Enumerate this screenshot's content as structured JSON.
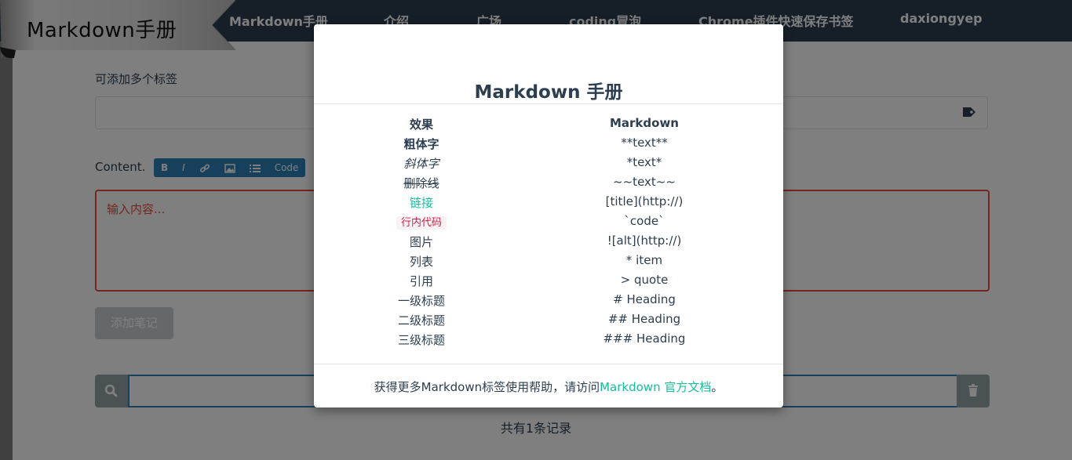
{
  "nav": {
    "logo": "Markdown手册",
    "items": [
      "Markdown手册",
      "介绍",
      "广场",
      "coding冒泡",
      "Chrome插件快速保存书签",
      "daxiongyep"
    ]
  },
  "form": {
    "tags_label": "可添加多个标签",
    "tag_icon": "tag-icon",
    "content_label": "Content.",
    "toolbar": [
      "B",
      "I",
      "link-icon",
      "image-icon",
      "list-icon",
      "Code"
    ],
    "toolbar_code": "Code",
    "textarea_placeholder": "输入内容...",
    "add_button": "添加笔记",
    "search_icon": "search-icon",
    "trash_icon": "trash-icon",
    "records": "共有1条记录"
  },
  "modal": {
    "title": "Markdown 手册",
    "headers": [
      "效果",
      "Markdown"
    ],
    "rows": [
      {
        "effect": "粗体字",
        "syntax": "**text**"
      },
      {
        "effect": "斜体字",
        "syntax": "*text*"
      },
      {
        "effect": "删除线",
        "syntax": "~~text~~"
      },
      {
        "effect": "链接",
        "syntax": "[title](http://)"
      },
      {
        "effect": "行内代码",
        "syntax": "`code`"
      },
      {
        "effect": "图片",
        "syntax": "![alt](http://)"
      },
      {
        "effect": "列表",
        "syntax": "* item"
      },
      {
        "effect": "引用",
        "syntax": "> quote"
      },
      {
        "effect": "一级标题",
        "syntax": "# Heading"
      },
      {
        "effect": "二级标题",
        "syntax": "## Heading"
      },
      {
        "effect": "三级标题",
        "syntax": "### Heading"
      }
    ],
    "footer_text": "获得更多Markdown标签使用帮助，请访问",
    "footer_link": "Markdown 官方文档",
    "footer_end": "。"
  },
  "colors": {
    "navbar": "#2c3e50",
    "accent": "#18bc9c",
    "danger": "#e74c3c",
    "toolbar": "#2c80b9"
  }
}
